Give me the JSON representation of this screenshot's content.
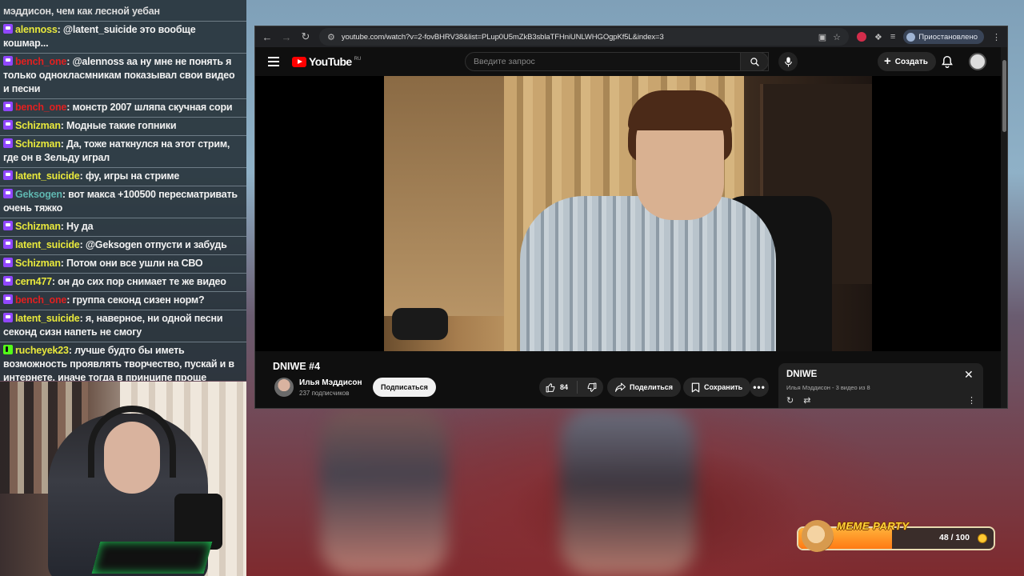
{
  "chat": {
    "header_partial": "мэддисон, чем как лесной уебан",
    "messages": [
      {
        "user": "alennoss",
        "color": "#e8e83c",
        "badge": "twitch",
        "text": "@latent_suicide это вообще кошмар..."
      },
      {
        "user": "bench_one",
        "color": "#e02020",
        "badge": "twitch",
        "text": "@alennoss аа ну мне не понять я только однокласмникам показывал свои видео и песни"
      },
      {
        "user": "bench_one",
        "color": "#e02020",
        "badge": "twitch",
        "text": "монстр 2007 шляпа скучная сори"
      },
      {
        "user": "Schizman",
        "color": "#e8e83c",
        "badge": "twitch",
        "text": "Модные такие гопники"
      },
      {
        "user": "Schizman",
        "color": "#e8e83c",
        "badge": "twitch",
        "text": "Да, тоже наткнулся на этот стрим, где он в Зельду играл"
      },
      {
        "user": "latent_suicide",
        "color": "#e8e83c",
        "badge": "twitch",
        "text": "фу, игры на стриме"
      },
      {
        "user": "Geksogen",
        "color": "#5fb6b0",
        "badge": "twitch",
        "text": "вот макса +100500 пересматривать очень тяжко"
      },
      {
        "user": "Schizman",
        "color": "#e8e83c",
        "badge": "twitch",
        "text": "Ну да"
      },
      {
        "user": "latent_suicide",
        "color": "#e8e83c",
        "badge": "twitch",
        "text": "@Geksogen отпусти и забудь"
      },
      {
        "user": "Schizman",
        "color": "#e8e83c",
        "badge": "twitch",
        "text": "Потом они все ушли на СВО"
      },
      {
        "user": "cern477",
        "color": "#e8e83c",
        "badge": "twitch",
        "text": "он до сих пор снимает те же видео"
      },
      {
        "user": "bench_one",
        "color": "#e02020",
        "badge": "twitch",
        "text": "группа секонд сизен норм?"
      },
      {
        "user": "latent_suicide",
        "color": "#e8e83c",
        "badge": "twitch",
        "text": "я, наверное, ни одной песни секонд сизн напеть не смогу"
      },
      {
        "user": "rucheyek23",
        "color": "#e8e83c",
        "badge": "kick",
        "text": "лучше будто бы иметь возможность проявлять творчество, пускай и в интернете. иначе тогда в принципе проще вообще не выделяться, потому что цепляться могут буквально к чему угодно, а ирл еще и пиздов раздать"
      }
    ]
  },
  "browser": {
    "url": "youtube.com/watch?v=2-fovBHRV38&list=PLup0U5mZkB3sblaTFHniUNLWHGOgpKf5L&index=3",
    "paused_label": "Приостановлено"
  },
  "youtube": {
    "logo_text": "YouTube",
    "logo_region": "RU",
    "search_placeholder": "Введите запрос",
    "create_label": "Создать",
    "video_title": "DNIWE #4",
    "channel_name": "Илья Мэддисон",
    "channel_subs": "237 подписчиков",
    "subscribe_label": "Подписаться",
    "likes": "84",
    "share_label": "Поделиться",
    "save_label": "Сохранить",
    "playlist": {
      "title": "DNIWE",
      "subtitle": "Илья Мэддисон - 3 видео из 8"
    }
  },
  "meme_party": {
    "title": "MEME PARTY",
    "current": 48,
    "max": 100,
    "count_text": "48 / 100"
  }
}
